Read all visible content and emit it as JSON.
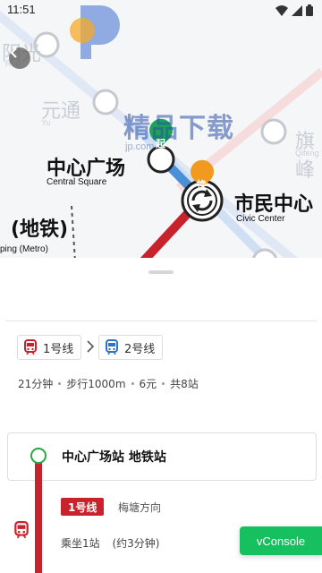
{
  "status_bar": {
    "time": "11:51"
  },
  "map": {
    "ghost_labels": {
      "top_left": "阳光",
      "top_left_en": "Rou",
      "yuan": "元通",
      "yuan_en": "Yu",
      "qifeng": "旗峰",
      "qifeng_en": "Qifeng"
    },
    "stations": {
      "central": {
        "cn": "中心广场",
        "en": "Central Square",
        "marker": "起"
      },
      "civic": {
        "cn": "市民中心",
        "en": "Civic Center",
        "marker": "换"
      },
      "metro": {
        "cn": "(地铁)",
        "en": "ping (Metro)"
      }
    },
    "watermark": {
      "text": "精品下载",
      "url": "jp.com"
    },
    "colors": {
      "line1": "#c8232c",
      "line2": "#4a90d9",
      "start_marker": "#1fa35a",
      "transfer_marker": "#f29a1f"
    }
  },
  "route": {
    "lines": [
      {
        "label": "1号线",
        "color": "#c8232c"
      },
      {
        "label": "2号线",
        "color": "#2a73c5"
      }
    ],
    "duration": "21分钟",
    "walk": "步行1000m",
    "price": "6元",
    "stops_total": "共8站"
  },
  "steps": {
    "start_station": "中心广场站 地铁站",
    "line_badge": "1号线",
    "direction": "梅塘方向",
    "ride": "乘坐1站",
    "ride_time": "(约3分钟)"
  },
  "vconsole": {
    "label": "vConsole"
  }
}
